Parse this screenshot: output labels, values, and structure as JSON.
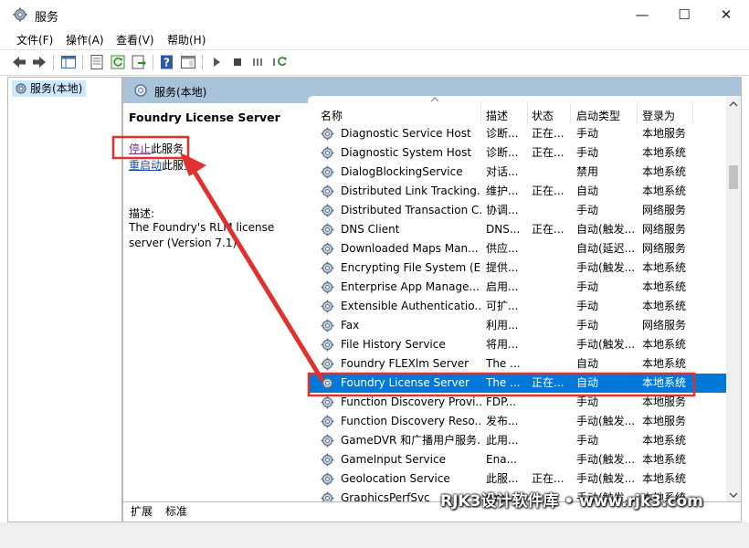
{
  "window": {
    "title": "服务"
  },
  "menu": [
    "文件(F)",
    "操作(A)",
    "查看(V)",
    "帮助(H)"
  ],
  "tree": {
    "item": "服务(本地)"
  },
  "pane": {
    "header": "服务(本地)",
    "service_name": "Foundry License Server",
    "stop_link": "停止",
    "stop_suffix": "此服务",
    "restart_link": "重启动",
    "restart_suffix": "此服务",
    "desc_label": "描述:",
    "desc_text": "The Foundry's RLM license server (Version 7.1)"
  },
  "columns": [
    "名称",
    "描述",
    "状态",
    "启动类型",
    "登录为"
  ],
  "rows": [
    {
      "name": "Diagnostic Service Host",
      "desc": "诊断...",
      "status": "正在...",
      "startup": "手动",
      "logon": "本地服务"
    },
    {
      "name": "Diagnostic System Host",
      "desc": "诊断...",
      "status": "正在...",
      "startup": "手动",
      "logon": "本地系统"
    },
    {
      "name": "DialogBlockingService",
      "desc": "对话...",
      "status": "",
      "startup": "禁用",
      "logon": "本地系统"
    },
    {
      "name": "Distributed Link Tracking...",
      "desc": "维护...",
      "status": "正在...",
      "startup": "自动",
      "logon": "本地系统"
    },
    {
      "name": "Distributed Transaction C...",
      "desc": "协调...",
      "status": "",
      "startup": "手动",
      "logon": "网络服务"
    },
    {
      "name": "DNS Client",
      "desc": "DNS...",
      "status": "正在...",
      "startup": "自动(触发...",
      "logon": "网络服务"
    },
    {
      "name": "Downloaded Maps Man...",
      "desc": "供应...",
      "status": "",
      "startup": "自动(延迟...",
      "logon": "网络服务"
    },
    {
      "name": "Encrypting File System (E...",
      "desc": "提供...",
      "status": "",
      "startup": "手动(触发...",
      "logon": "本地系统"
    },
    {
      "name": "Enterprise App Manage...",
      "desc": "启用...",
      "status": "",
      "startup": "手动",
      "logon": "本地系统"
    },
    {
      "name": "Extensible Authenticatio...",
      "desc": "可扩...",
      "status": "",
      "startup": "手动",
      "logon": "本地系统"
    },
    {
      "name": "Fax",
      "desc": "利用...",
      "status": "",
      "startup": "手动",
      "logon": "网络服务"
    },
    {
      "name": "File History Service",
      "desc": "将用...",
      "status": "",
      "startup": "手动(触发...",
      "logon": "本地系统"
    },
    {
      "name": "Foundry FLEXlm Server",
      "desc": "The ...",
      "status": "",
      "startup": "自动",
      "logon": "本地系统"
    },
    {
      "name": "Foundry License Server",
      "desc": "The ...",
      "status": "正在...",
      "startup": "自动",
      "logon": "本地系统",
      "selected": true
    },
    {
      "name": "Function Discovery Provi...",
      "desc": "FDP...",
      "status": "",
      "startup": "手动",
      "logon": "本地服务"
    },
    {
      "name": "Function Discovery Reso...",
      "desc": "发布...",
      "status": "",
      "startup": "手动(触发...",
      "logon": "本地服务"
    },
    {
      "name": "GameDVR 和广播用户服务...",
      "desc": "此用...",
      "status": "",
      "startup": "手动",
      "logon": "本地系统"
    },
    {
      "name": "GameInput Service",
      "desc": "Ena...",
      "status": "",
      "startup": "手动(触发...",
      "logon": "本地系统"
    },
    {
      "name": "Geolocation Service",
      "desc": "此服...",
      "status": "正在...",
      "startup": "手动(触发...",
      "logon": "本地系统"
    },
    {
      "name": "GraphicsPerfSvc",
      "desc": "Gra...",
      "status": "",
      "startup": "手动(触发...",
      "logon": "本地系统"
    }
  ],
  "tabs": [
    "扩展",
    "标准"
  ],
  "watermark": "RJK3设计软件库 • www.rjk3.com",
  "colors": {
    "selection": "#0078d7",
    "pane_header": "#a9c3da",
    "annotation": "#e0312f"
  }
}
